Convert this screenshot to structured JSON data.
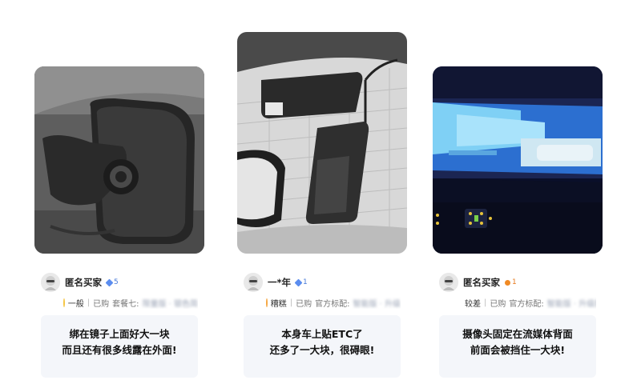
{
  "reviews": [
    {
      "username": "匿名买家",
      "level": "5",
      "level_color": "#4a7bd8",
      "rating": "一般",
      "purchased": "已购",
      "sku": "套餐七:",
      "sku_extra": "限量版 · 银色简",
      "comment_line1": "绑在镜子上面好大一块",
      "comment_line2": "而且还有很多线露在外面!",
      "photo_icon": "rearview-mirror-dashcam-photo"
    },
    {
      "username": "一*年",
      "level": "1",
      "level_color": "#4a7bd8",
      "rating": "糟糕",
      "purchased": "已购",
      "sku": "官方标配:",
      "sku_extra": "智能版 · 升级",
      "comment_line1": "本身车上贴ETC了",
      "comment_line2": "还多了一大块，很碍眼!",
      "photo_icon": "windshield-etc-dashcam-photo"
    },
    {
      "username": "匿名买家",
      "level": "1",
      "level_color": "#e67a1f",
      "rating": "较差",
      "purchased": "已购",
      "sku": "官方标配:",
      "sku_extra": "智能版 · 升级版",
      "comment_line1": "摄像头固定在流媒体背面",
      "comment_line2": "前面会被挡住一大块!",
      "photo_icon": "streaming-mirror-photo"
    }
  ]
}
